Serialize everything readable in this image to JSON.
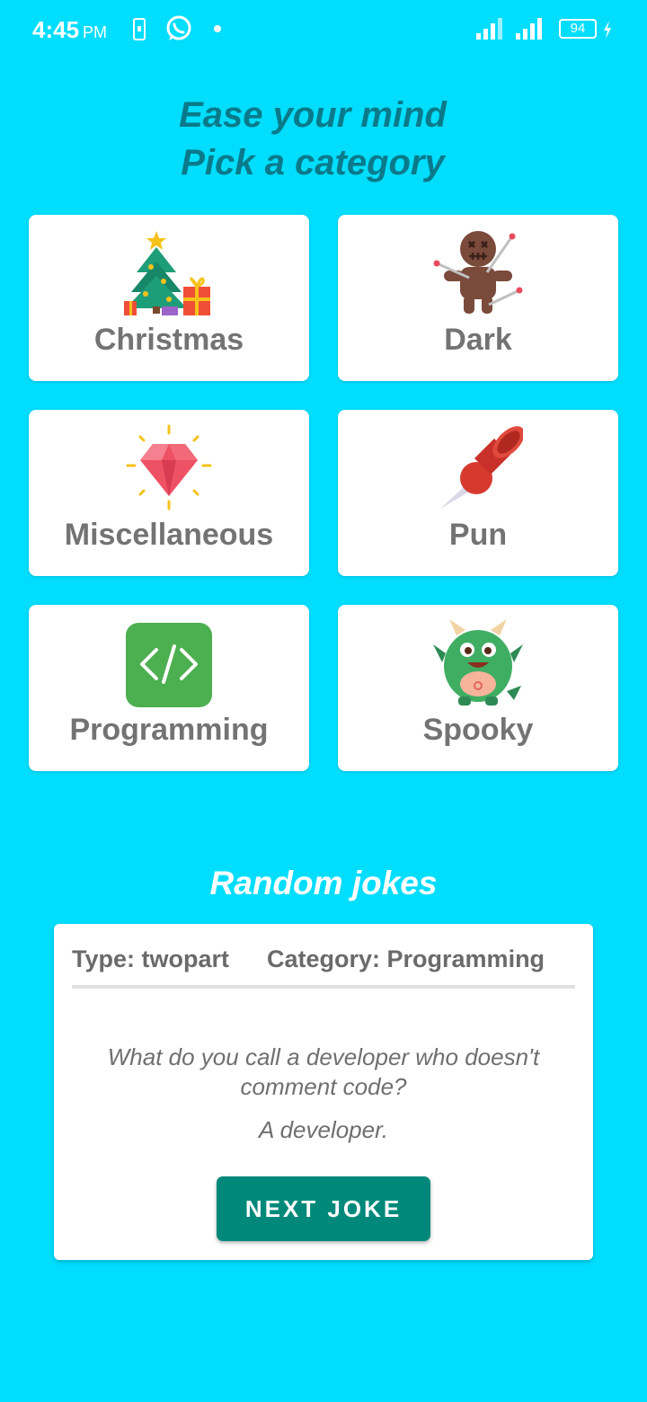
{
  "status_bar": {
    "time": "4:45",
    "ampm": "PM",
    "battery": "94",
    "icons": [
      "sim-card-icon",
      "whatsapp-icon",
      "dot-icon",
      "signal-icon",
      "signal-icon",
      "battery-icon",
      "charging-icon"
    ]
  },
  "header": {
    "line1": "Ease your mind",
    "line2": "Pick a category"
  },
  "categories": [
    {
      "label": "Christmas",
      "icon": "christmas-tree-icon"
    },
    {
      "label": "Dark",
      "icon": "voodoo-doll-icon"
    },
    {
      "label": "Miscellaneous",
      "icon": "gem-icon"
    },
    {
      "label": "Pun",
      "icon": "pushpin-icon"
    },
    {
      "label": "Programming",
      "icon": "code-icon"
    },
    {
      "label": "Spooky",
      "icon": "monster-icon"
    }
  ],
  "random": {
    "title": "Random jokes",
    "type_label": "Type: twopart",
    "category_label": "Category: Programming",
    "setup": "What do you call a developer who doesn't comment code?",
    "delivery": "A developer.",
    "button": "NEXT JOKE"
  },
  "colors": {
    "background": "#00DDFD",
    "title_text": "#0A7A8A",
    "button": "#00897B",
    "card_text": "#737373"
  }
}
